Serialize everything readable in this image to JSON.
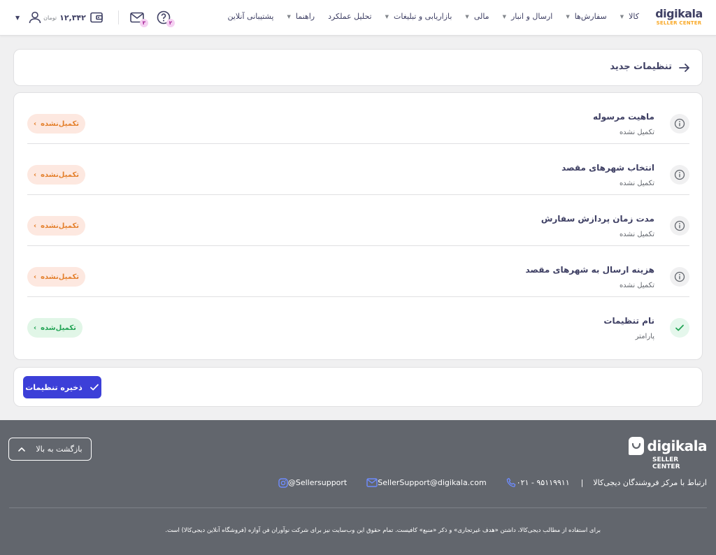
{
  "header": {
    "logo_word": "digikala",
    "logo_sub": "SELLER CENTER",
    "nav": [
      {
        "label": "کالا",
        "caret": true
      },
      {
        "label": "سفارش‌ها",
        "caret": true
      },
      {
        "label": "ارسال و انبار",
        "caret": true
      },
      {
        "label": "مالی",
        "caret": true
      },
      {
        "label": "بازاریابی و تبلیغات",
        "caret": true
      },
      {
        "label": "تحلیل عملکرد",
        "caret": false
      },
      {
        "label": "راهنما",
        "caret": true
      },
      {
        "label": "پشتیبانی آنلاین",
        "caret": false
      }
    ],
    "wallet_amount": "۱۲,۳۴۲",
    "wallet_currency": "تومان",
    "messages_badge": "۳",
    "help_badge": "۲"
  },
  "page": {
    "title": "تنظیمات جدید"
  },
  "settings": [
    {
      "title": "ماهیت مرسوله",
      "subtitle": "تکمیل نشده",
      "status": "تکمیل‌نشده",
      "state": "pending"
    },
    {
      "title": "انتخاب شهرهای مقصد",
      "subtitle": "تکمیل نشده",
      "status": "تکمیل‌نشده",
      "state": "pending"
    },
    {
      "title": "مدت زمان پردازش سفارش",
      "subtitle": "تکمیل نشده",
      "status": "تکمیل‌نشده",
      "state": "pending"
    },
    {
      "title": "هزینه ارسال به شهرهای مقصد",
      "subtitle": "تکمیل نشده",
      "status": "تکمیل‌نشده",
      "state": "pending"
    },
    {
      "title": "نام تنظیمات",
      "subtitle": "پارامتر",
      "status": "تکمیل‌شده",
      "state": "done"
    }
  ],
  "actions": {
    "save_label": "ذخیره تنظیمات"
  },
  "footer": {
    "logo_word": "digikala",
    "logo_sub": "SELLER CENTER",
    "back_to_top": "بازگشت به بالا",
    "contact_label": "ارتباط با مرکز فروشندگان دیجی‌کالا",
    "phone": "۰۲۱ - ۹۵۱۱۹۹۱۱",
    "email": "SellerSupport@digikala.com",
    "instagram": "@Sellersupport",
    "copyright": "برای استفاده از مطالب دیجی‌کالا، داشتن «هدف غیرتجاری» و ذکر «منبع» کافیست. تمام حقوق این وب‌سایت نیز برای شرکت نوآوران فن آوازه (فروشگاه آنلاین دیجی‌کالا) است."
  },
  "colors": {
    "primary": "#3c3fd8",
    "pending_bg": "#fde8e0",
    "pending_text": "#e4812e",
    "done_bg": "#e1f6e7",
    "done_text": "#23a455",
    "footer_bg": "#62666d",
    "logo_accent": "#f9a825"
  }
}
